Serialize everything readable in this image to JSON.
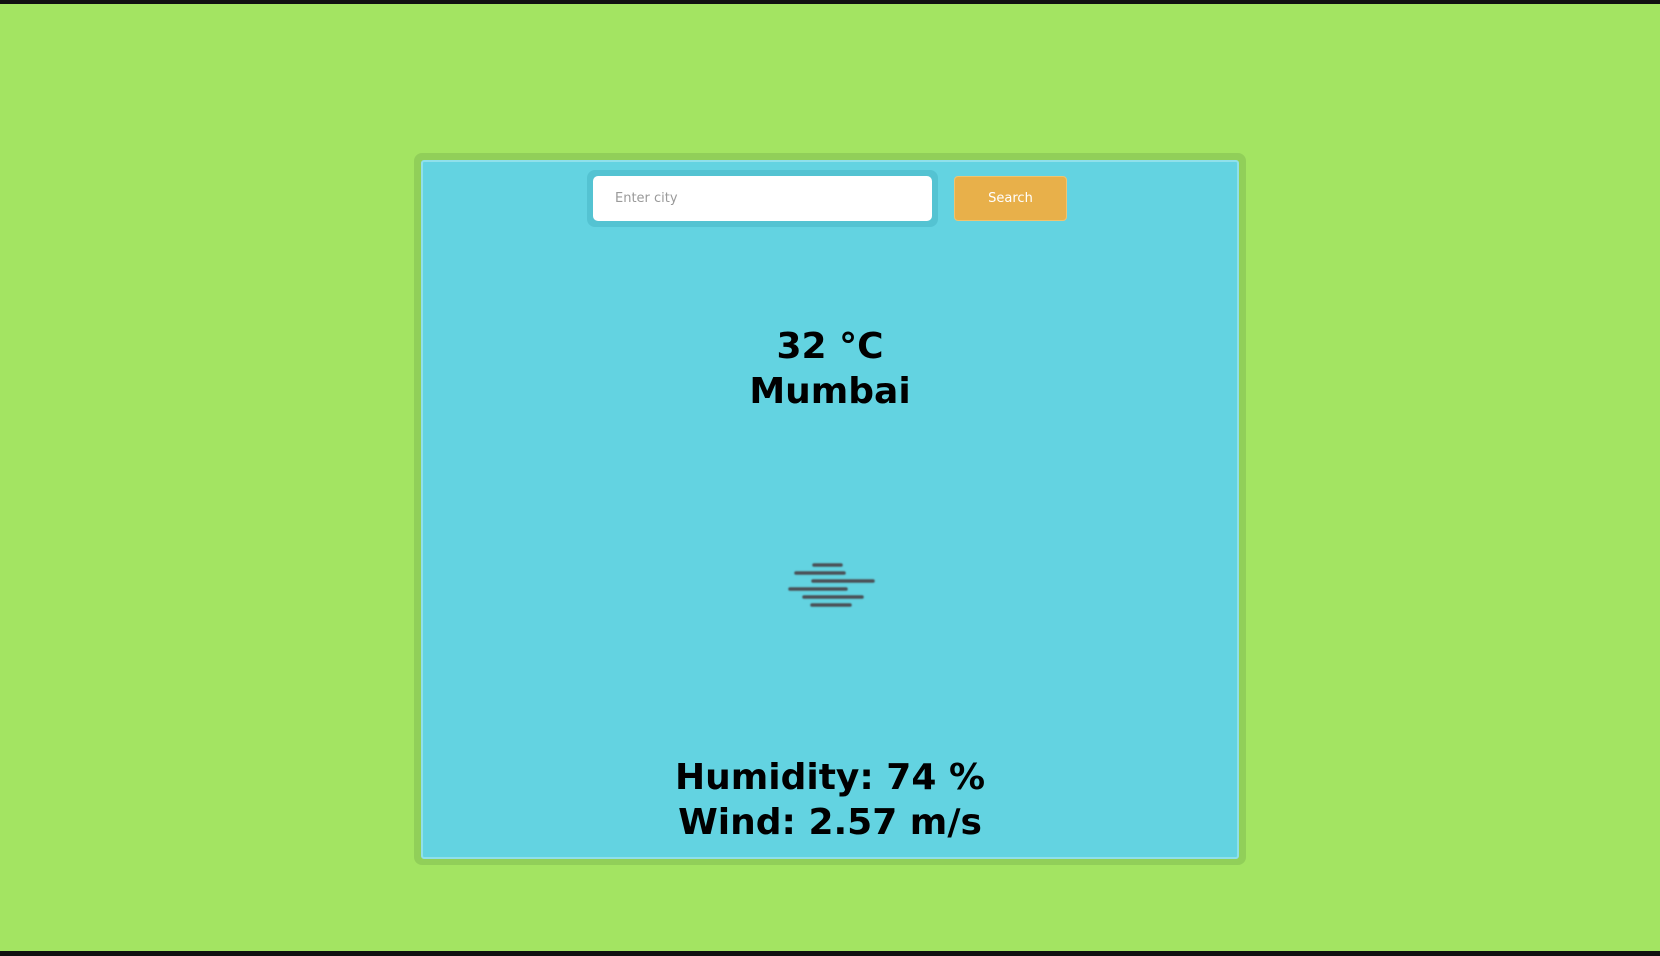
{
  "search": {
    "placeholder": "Enter city",
    "value": "",
    "button_label": "Search"
  },
  "weather": {
    "temperature": "32 °C",
    "city": "Mumbai",
    "icon": "mist-icon",
    "humidity": "Humidity: 74 %",
    "wind": "Wind: 2.57 m/s"
  },
  "colors": {
    "page_background": "#a3e462",
    "card_background": "#63d3e1",
    "button_background": "#e8b04a"
  }
}
